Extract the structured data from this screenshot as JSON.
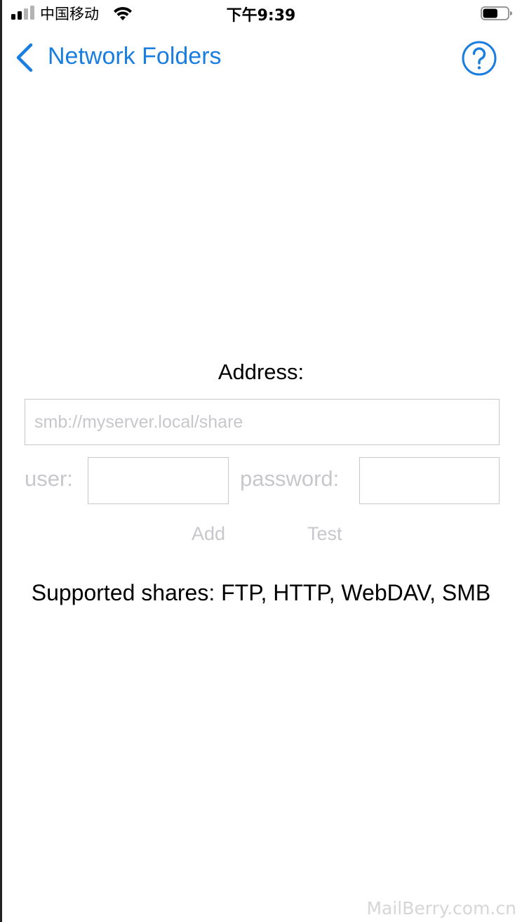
{
  "status_bar": {
    "carrier": "中国移动",
    "time": "下午9:39",
    "battery_level": 0.6,
    "icons": [
      "signal-icon",
      "wifi-icon",
      "battery-icon"
    ]
  },
  "nav": {
    "back_title": "Network Folders",
    "back_icon": "chevron-left-icon",
    "help_icon": "question-circle-icon",
    "accent_color": "#1a7ee0"
  },
  "form": {
    "address_label": "Address:",
    "address_value": "",
    "address_placeholder": "smb://myserver.local/share",
    "user_label": "user:",
    "user_value": "",
    "password_label": "password:",
    "password_value": "",
    "add_label": "Add",
    "test_label": "Test",
    "disabled_color": "#c7c7cc"
  },
  "supported_text": "Supported shares: FTP, HTTP, WebDAV, SMB",
  "watermark": "MailBerry.com.cn"
}
